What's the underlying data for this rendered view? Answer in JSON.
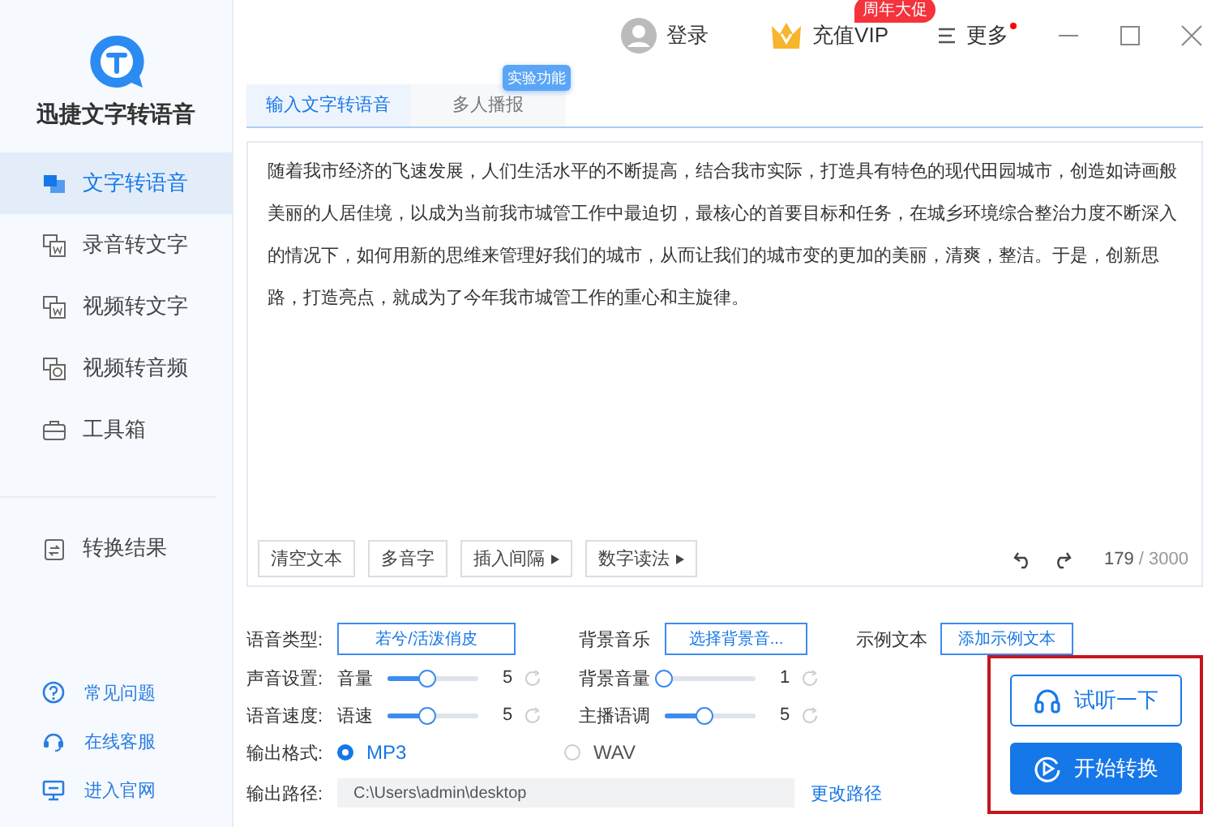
{
  "app": {
    "name": "迅捷文字转语音"
  },
  "sidebar": {
    "items": [
      {
        "label": "文字转语音",
        "selected": true
      },
      {
        "label": "录音转文字",
        "selected": false
      },
      {
        "label": "视频转文字",
        "selected": false
      },
      {
        "label": "视频转音频",
        "selected": false
      },
      {
        "label": "工具箱",
        "selected": false
      }
    ],
    "results": {
      "label": "转换结果",
      "selected": false
    },
    "links": [
      {
        "kind": "help",
        "label": "常见问题"
      },
      {
        "kind": "service",
        "label": "在线客服"
      },
      {
        "kind": "site",
        "label": "进入官网"
      }
    ]
  },
  "topbar": {
    "login": "登录",
    "vip": "充值VIP",
    "vip_badge": "周年大促",
    "more": "更多",
    "notification": true
  },
  "tabs": [
    {
      "label": "输入文字转语音",
      "selected": true
    },
    {
      "label": "多人播报",
      "selected": false,
      "badge": "实验功能"
    }
  ],
  "editor": {
    "text": "随着我市经济的飞速发展，人们生活水平的不断提高，结合我市实际，打造具有特色的现代田园城市，创造如诗画般美丽的人居佳境，以成为当前我市城管工作中最迫切，最核心的首要目标和任务，在城乡环境综合整治力度不断深入的情况下，如何用新的思维来管理好我们的城市，从而让我们的城市变的更加的美丽，清爽，整洁。于是，创新思路，打造亮点，就成为了今年我市城管工作的重心和主旋律。",
    "tools": [
      {
        "label": "清空文本",
        "menu": false
      },
      {
        "label": "多音字",
        "menu": false
      },
      {
        "label": "插入间隔",
        "menu": true
      },
      {
        "label": "数字读法",
        "menu": true
      }
    ],
    "count": "179",
    "limit": "/ 3000"
  },
  "settings": {
    "voice": {
      "label": "语音类型:",
      "value": "若兮/活泼俏皮"
    },
    "music": {
      "label": "背景音乐",
      "value": "选择背景音..."
    },
    "sample": {
      "label": "示例文本",
      "value": "添加示例文本"
    },
    "sound": {
      "label": "声音设置:",
      "sliders": [
        {
          "name": "音量",
          "level": 0.45,
          "reading": "5"
        },
        {
          "name": "背景音量",
          "level": 0,
          "reading": "1"
        }
      ]
    },
    "speed": {
      "label": "语音速度:",
      "sliders": [
        {
          "name": "语速",
          "level": 0.45,
          "reading": "5"
        },
        {
          "name": "主播语调",
          "level": 0.45,
          "reading": "5"
        }
      ]
    },
    "format": {
      "label": "输出格式:",
      "options": [
        {
          "label": "MP3",
          "selected": true
        },
        {
          "label": "WAV",
          "selected": false
        }
      ]
    },
    "path": {
      "label": "输出路径:",
      "value": "C:\\Users\\admin\\desktop",
      "action": "更改路径"
    }
  },
  "actions": [
    {
      "kind": "listen",
      "label": "试听一下"
    },
    {
      "kind": "convert",
      "label": "开始转换"
    }
  ]
}
